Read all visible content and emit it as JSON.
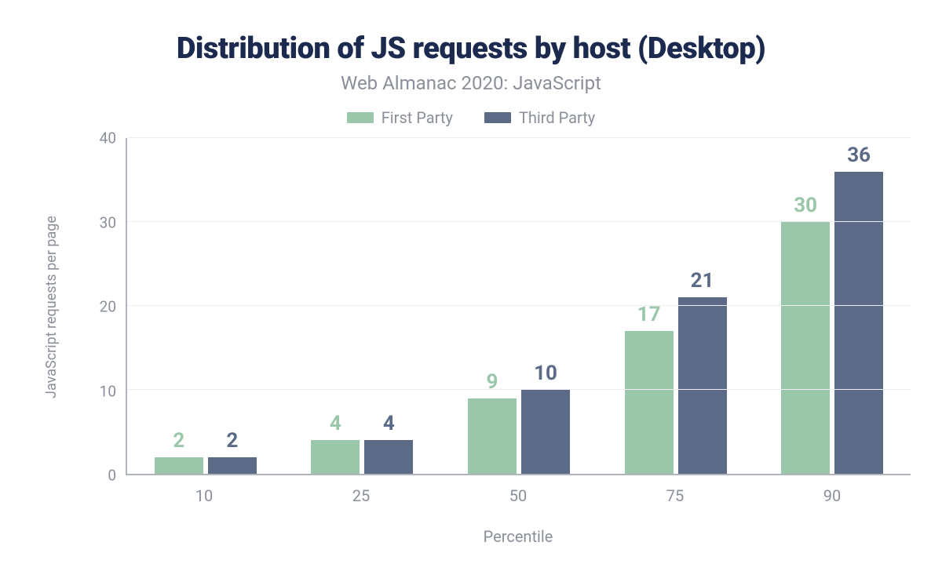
{
  "chart_data": {
    "type": "bar",
    "title": "Distribution of JS requests by host (Desktop)",
    "subtitle": "Web Almanac 2020: JavaScript",
    "xlabel": "Percentile",
    "ylabel": "JavaScript requests per page",
    "categories": [
      "10",
      "25",
      "50",
      "75",
      "90"
    ],
    "series": [
      {
        "name": "First Party",
        "color": "#9ac7a9",
        "values": [
          2,
          4,
          9,
          17,
          30
        ]
      },
      {
        "name": "Third Party",
        "color": "#5b6a86",
        "values": [
          2,
          4,
          10,
          21,
          36
        ]
      }
    ],
    "ylim": [
      0,
      40
    ],
    "yticks": [
      0,
      10,
      20,
      30,
      40
    ],
    "grid": true,
    "legend_position": "top"
  }
}
